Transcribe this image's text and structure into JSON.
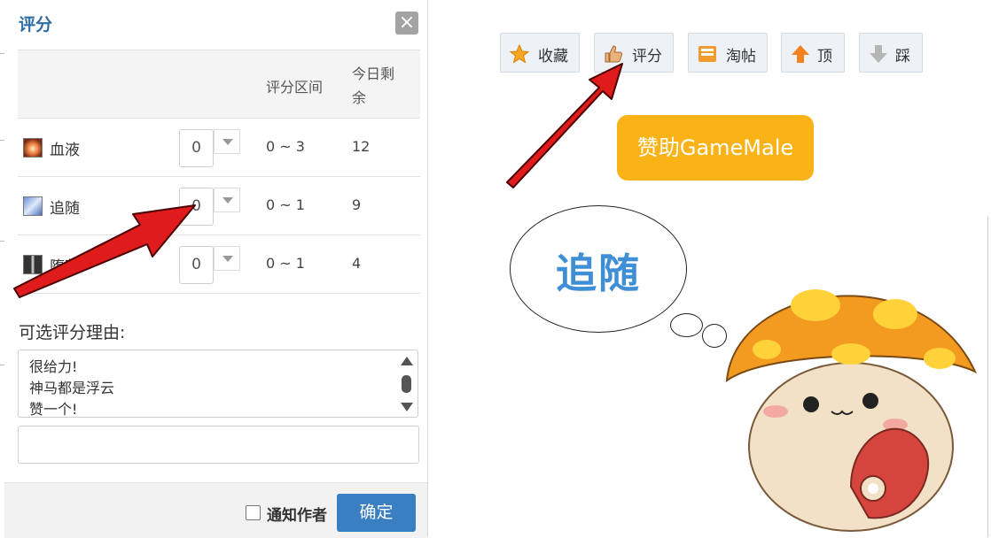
{
  "dialog": {
    "title": "评分",
    "close_glyph": "×",
    "headers": {
      "range": "评分区间",
      "remaining_line1": "今日剩",
      "remaining_line2": "余"
    },
    "rows": [
      {
        "name": "血液",
        "icon": "blood-icon",
        "value": "0",
        "range": "0 ~ 3",
        "remaining": "12"
      },
      {
        "name": "追随",
        "icon": "follow-icon",
        "value": "0",
        "range": "0 ~ 1",
        "remaining": "9"
      },
      {
        "name": "堕落",
        "icon": "fall-icon",
        "value": "0",
        "range": "0 ~ 1",
        "remaining": "4"
      }
    ],
    "reason_label": "可选评分理由:",
    "reasons": [
      "很给力!",
      "神马都是浮云",
      "赞一个!"
    ],
    "reason_input_value": "",
    "notify_label": "通知作者",
    "notify_checked": false,
    "confirm_label": "确定"
  },
  "toolbar": {
    "buttons": [
      {
        "label": "收藏",
        "icon": "star-icon"
      },
      {
        "label": "评分",
        "icon": "thumbs-up-icon"
      },
      {
        "label": "淘帖",
        "icon": "tray-icon"
      },
      {
        "label": "顶",
        "icon": "arrow-up-icon"
      },
      {
        "label": "踩",
        "icon": "arrow-down-icon"
      }
    ]
  },
  "sponsor_label": "赞助GameMale",
  "speech_bubble_text": "追随",
  "colors": {
    "title_blue": "#2e6da4",
    "confirm_blue": "#3a7fc1",
    "sponsor_orange": "#f9b316",
    "arrow_red": "#e01b1b",
    "bubble_text_blue": "#3f8fd6"
  }
}
